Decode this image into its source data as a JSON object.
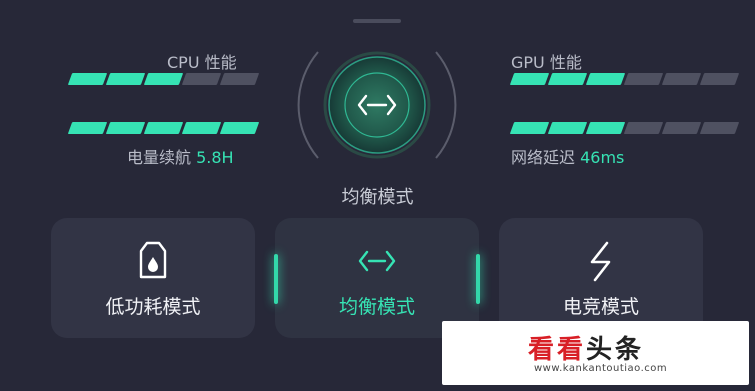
{
  "cpu": {
    "label": "CPU 性能",
    "level": 3,
    "segments": 5
  },
  "battery": {
    "label": "电量续航",
    "value": "5.8H",
    "level": 5,
    "segments": 5
  },
  "gpu": {
    "label": "GPU 性能",
    "level": 3,
    "segments": 6
  },
  "latency": {
    "label": "网络延迟",
    "value": "46ms",
    "level": 3,
    "segments": 6
  },
  "current_mode": "均衡模式",
  "modes": [
    {
      "label": "低功耗模式",
      "icon": "battery-drop-icon",
      "active": false
    },
    {
      "label": "均衡模式",
      "icon": "balance-arrows-icon",
      "active": true
    },
    {
      "label": "电竞模式",
      "icon": "lightning-icon",
      "active": false
    }
  ],
  "colors": {
    "accent": "#36e3b4",
    "background": "#272838",
    "card": "#323445",
    "inactive_segment": "#4f5161"
  },
  "watermark": {
    "brand": "看看头条",
    "url": "www.kankantoutiao.com"
  }
}
